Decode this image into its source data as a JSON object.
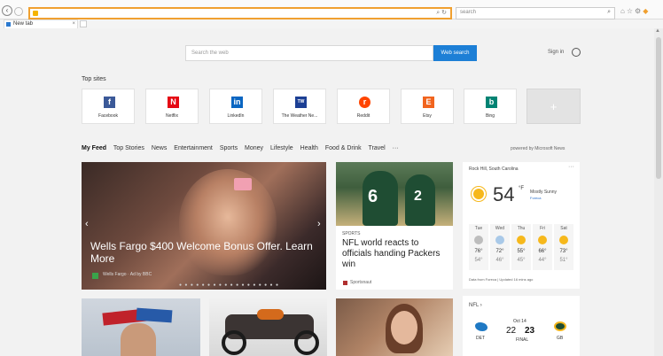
{
  "browser": {
    "search_box_placeholder": "search",
    "tab_title": "New tab",
    "tab_close": "×"
  },
  "page": {
    "web_search_placeholder": "Search the web",
    "web_search_button": "Web search",
    "sign_in": "Sign in"
  },
  "top_sites": {
    "title": "Top sites",
    "tiles": [
      {
        "label": "Facebook",
        "glyph": "f",
        "color": "#3b5998"
      },
      {
        "label": "Netflix",
        "glyph": "N",
        "color": "#e50914"
      },
      {
        "label": "LinkedIn",
        "glyph": "in",
        "color": "#0a66c2"
      },
      {
        "label": "The Weather Ne...",
        "glyph": "TW",
        "color": "#1c3f94"
      },
      {
        "label": "Reddit",
        "glyph": "r",
        "color": "#ff4500"
      },
      {
        "label": "Etsy",
        "glyph": "E",
        "color": "#f1641e"
      },
      {
        "label": "Bing",
        "glyph": "b",
        "color": "#008373"
      }
    ],
    "add_label": "+"
  },
  "feed": {
    "tabs": [
      "My Feed",
      "Top Stories",
      "News",
      "Entertainment",
      "Sports",
      "Money",
      "Lifestyle",
      "Health",
      "Food & Drink",
      "Travel",
      "···"
    ],
    "powered_by": "powered by Microsoft News"
  },
  "hero": {
    "title": "Wells Fargo $400 Welcome Bonus Offer. Learn More",
    "source": "Wells Fargo · Ad by BBC",
    "dots": "● ● ● ● ● ● ● ● ● ● ● ● ● ● ● ● ● ●"
  },
  "nfl_card": {
    "tag": "SPORTS",
    "title": "NFL world reacts to officials handing Packers win",
    "source": "Sportsnaut",
    "num1": "6",
    "num2": "2"
  },
  "weather": {
    "location": "Rock Hill, South Carolina",
    "more": "···",
    "temp": "54",
    "unit": "°F",
    "condition": "Mostly Sunny",
    "source": "Foreca",
    "forecast": [
      {
        "day": "Tue",
        "hi": "76°",
        "lo": "54°",
        "icon_color": "#bdbdbd"
      },
      {
        "day": "Wed",
        "hi": "72°",
        "lo": "46°",
        "icon_color": "#a9c9e8"
      },
      {
        "day": "Thu",
        "hi": "55°",
        "lo": "45°",
        "icon_color": "#f6b81c"
      },
      {
        "day": "Fri",
        "hi": "66°",
        "lo": "44°",
        "icon_color": "#f6b81c"
      },
      {
        "day": "Sat",
        "hi": "73°",
        "lo": "51°",
        "icon_color": "#f6b81c"
      }
    ],
    "footer": "Data from Foreca | Updated 16 mins ago"
  },
  "nfl_widget": {
    "title": "NFL ›",
    "date": "Oct 14",
    "score1": "22",
    "score2": "23",
    "status": "FINAL",
    "team1": "DET",
    "team2": "GB"
  }
}
